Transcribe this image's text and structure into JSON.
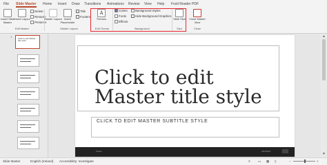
{
  "tabs": [
    {
      "id": "file",
      "label": "File"
    },
    {
      "id": "slide-master",
      "label": "Slide Master",
      "active": true
    },
    {
      "id": "home",
      "label": "Home"
    },
    {
      "id": "insert",
      "label": "Insert"
    },
    {
      "id": "draw",
      "label": "Draw"
    },
    {
      "id": "transitions",
      "label": "Transitions"
    },
    {
      "id": "animations",
      "label": "Animations"
    },
    {
      "id": "review",
      "label": "Review"
    },
    {
      "id": "view",
      "label": "View"
    },
    {
      "id": "help",
      "label": "Help"
    },
    {
      "id": "foxit",
      "label": "Foxit Reader PDF"
    }
  ],
  "ribbon": {
    "edit_master": {
      "insert_slide_master": "Insert Slide Master",
      "insert_layout": "Insert Layout",
      "delete": "Delete",
      "rename": "Rename",
      "preserve": "Preserve",
      "group_label": "Edit Master"
    },
    "master_layout": {
      "master_layout": "Master Layout",
      "insert_placeholder": "Insert Placeholder",
      "title": "Title",
      "footers": "Footers",
      "group_label": "Master Layout"
    },
    "edit_theme": {
      "themes": "Themes",
      "group_label": "Edit Theme"
    },
    "background": {
      "colors": "Colors",
      "fonts": "Fonts",
      "effects": "Effects",
      "background_styles": "Background Styles",
      "hide_background_graphics": "Hide Background Graphics",
      "group_label": "Background"
    },
    "size": {
      "slide_size": "Slide Size",
      "group_label": "Size"
    },
    "close": {
      "close_master_view": "Close Master View",
      "group_label": "Close"
    }
  },
  "thumbnails": {
    "first_slide_text": "Click to edit Master title style",
    "numbers": [
      "1"
    ]
  },
  "slide": {
    "title": "Click to edit Master title style",
    "subtitle": "CLICK TO EDIT MASTER SUBTITLE STYLE",
    "footer_left": "Footer",
    "footer_date": "4/21/2021"
  },
  "statusbar": {
    "view": "Slide Master",
    "language": "English (Ireland)",
    "accessibility": "Accessibility: Investigate"
  },
  "colors": {
    "accent": "#b7472a",
    "highlight": "#e8252b"
  }
}
